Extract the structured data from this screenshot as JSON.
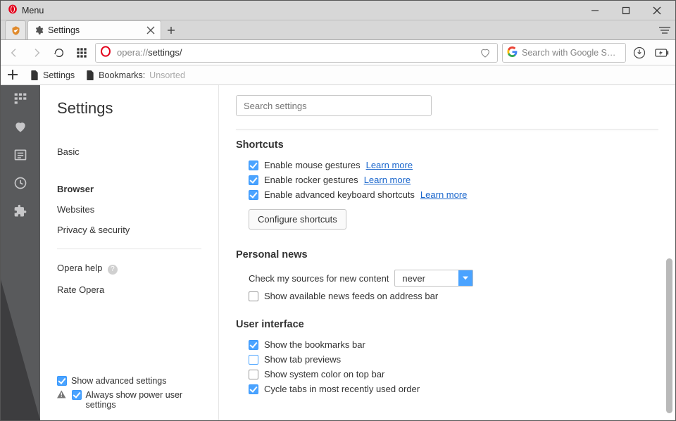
{
  "window": {
    "menu_label": "Menu"
  },
  "tab": {
    "title": "Settings"
  },
  "address": {
    "scheme": "opera://",
    "path": "settings/"
  },
  "searchbox": {
    "placeholder": "Search with Google S…"
  },
  "bookmarksbar": {
    "items": [
      {
        "label": "Settings"
      },
      {
        "label_prefix": "Bookmarks: ",
        "label_fade": "Unsorted"
      }
    ]
  },
  "settings": {
    "title": "Settings",
    "nav": {
      "basic": "Basic",
      "browser": "Browser",
      "websites": "Websites",
      "privacy": "Privacy & security",
      "help": "Opera help",
      "rate": "Rate Opera"
    },
    "footer": {
      "show_advanced": "Show advanced settings",
      "power_user": "Always show power user settings"
    },
    "search_placeholder": "Search settings",
    "sections": {
      "shortcuts": {
        "title": "Shortcuts",
        "mouse": "Enable mouse gestures",
        "rocker": "Enable rocker gestures",
        "keyboard": "Enable advanced keyboard shortcuts",
        "learn_more": "Learn more",
        "configure": "Configure shortcuts"
      },
      "news": {
        "title": "Personal news",
        "check_label": "Check my sources for new content",
        "check_value": "never",
        "feeds": "Show available news feeds on address bar"
      },
      "ui": {
        "title": "User interface",
        "bookmarks_bar": "Show the bookmarks bar",
        "tab_previews": "Show tab previews",
        "system_color": "Show system color on top bar",
        "cycle_tabs": "Cycle tabs in most recently used order"
      }
    }
  }
}
